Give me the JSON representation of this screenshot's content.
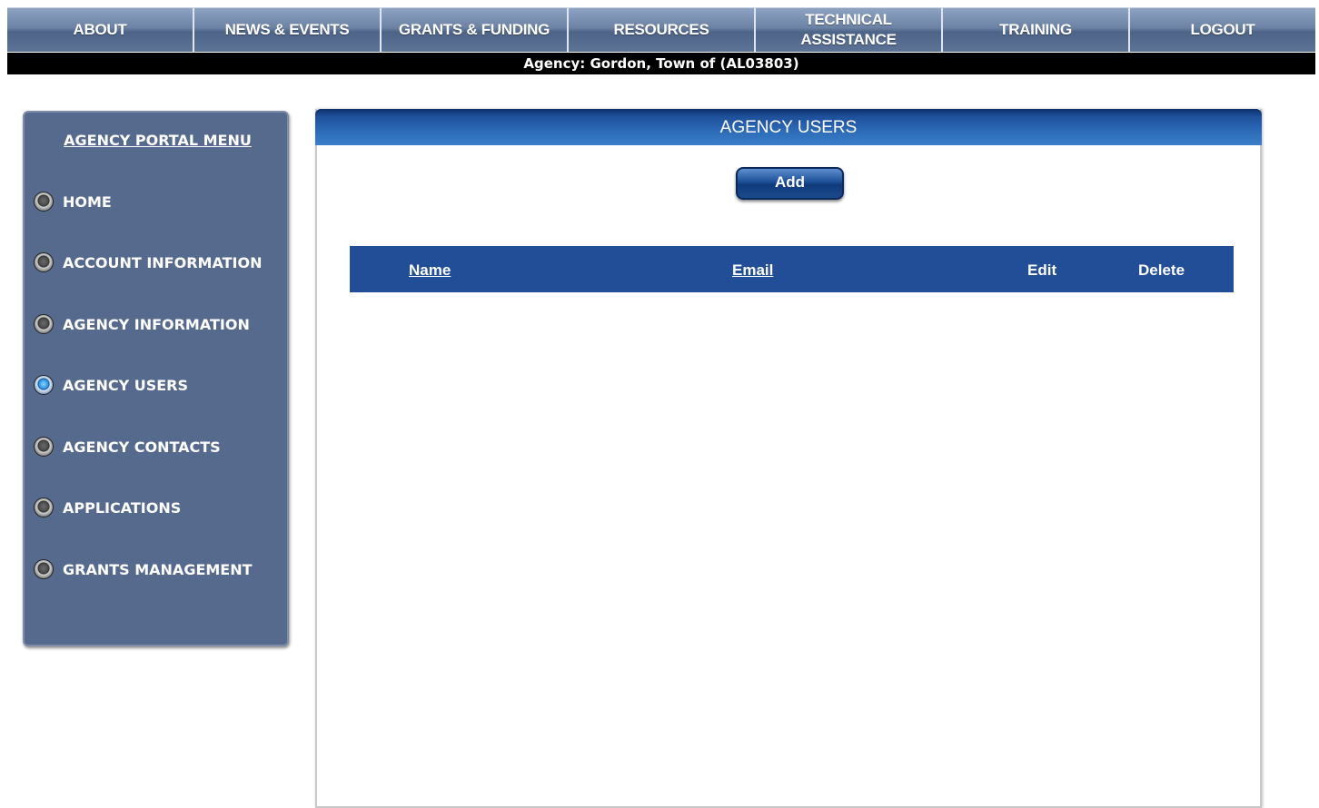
{
  "nav": {
    "items": [
      "ABOUT",
      "NEWS & EVENTS",
      "GRANTS & FUNDING",
      "RESOURCES",
      "TECHNICAL ASSISTANCE",
      "TRAINING",
      "LOGOUT"
    ],
    "technical_line1": "TECHNICAL",
    "technical_line2": "ASSISTANCE"
  },
  "agency_bar": "Agency: Gordon, Town of (AL03803)",
  "sidebar": {
    "title": "AGENCY PORTAL MENU",
    "items": [
      {
        "label": "HOME",
        "active": false
      },
      {
        "label": "ACCOUNT INFORMATION",
        "active": false
      },
      {
        "label": "AGENCY INFORMATION",
        "active": false
      },
      {
        "label": "AGENCY USERS",
        "active": true
      },
      {
        "label": "AGENCY CONTACTS",
        "active": false
      },
      {
        "label": "APPLICATIONS",
        "active": false
      },
      {
        "label": "GRANTS MANAGEMENT",
        "active": false
      }
    ]
  },
  "main": {
    "title": "AGENCY USERS",
    "add_label": "Add",
    "table": {
      "columns": [
        "Name",
        "Email",
        "Edit",
        "Delete"
      ]
    }
  },
  "colors": {
    "nav_bg": "#6c82a4",
    "sidebar_bg": "#566a8e",
    "header_blue": "#2c6ab7",
    "table_header": "#224e97"
  }
}
